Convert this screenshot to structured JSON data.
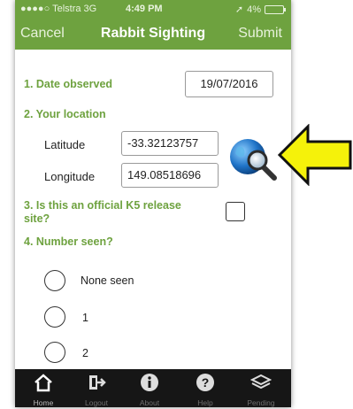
{
  "status": {
    "carrier": "●●●●○ Telstra  3G",
    "time": "4:49 PM",
    "battery": "4%"
  },
  "nav": {
    "cancel": "Cancel",
    "title": "Rabbit Sighting",
    "submit": "Submit"
  },
  "form": {
    "date_label": "1. Date observed",
    "date_value": "19/07/2016",
    "location_label": "2. Your location",
    "latitude_label": "Latitude",
    "latitude_value": "-33.32123757",
    "longitude_label": "Longitude",
    "longitude_value": "149.08518696",
    "k5_label_line1": "3. Is this an official K5 release",
    "k5_label_line2": "site?",
    "number_label": "4. Number seen?",
    "options": [
      "None seen",
      "1",
      "2"
    ]
  },
  "tabs": [
    {
      "label": "Home",
      "icon": "home-icon"
    },
    {
      "label": "Logout",
      "icon": "logout-icon"
    },
    {
      "label": "About",
      "icon": "info-icon"
    },
    {
      "label": "Help",
      "icon": "help-icon"
    },
    {
      "label": "Pending",
      "icon": "layers-icon"
    }
  ],
  "colors": {
    "accent": "#6ea23f",
    "tabbar": "#161616",
    "arrow": "#f5f20a"
  }
}
